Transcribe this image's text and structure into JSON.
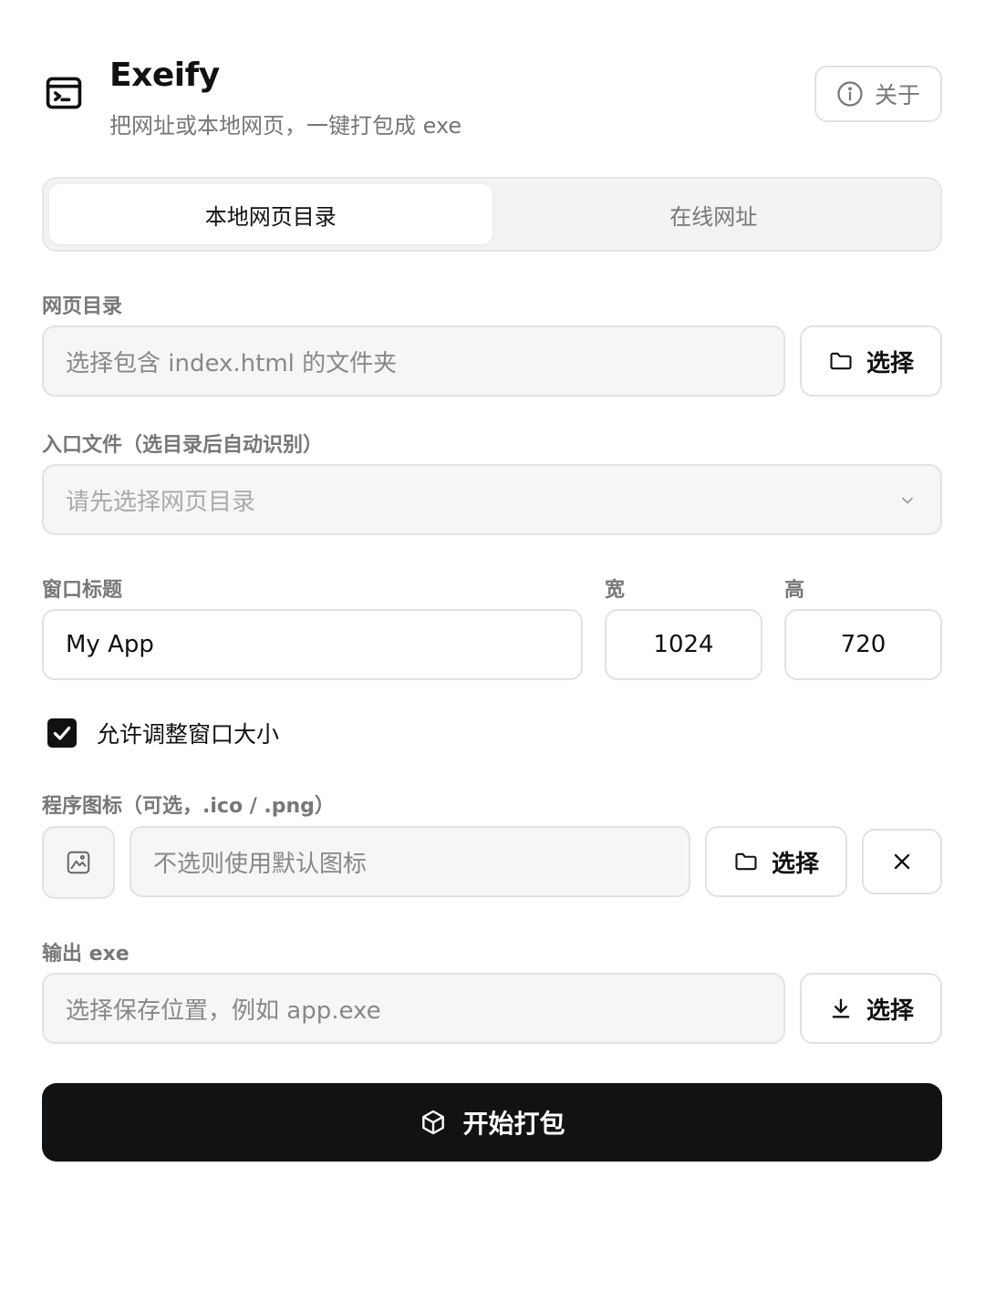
{
  "header": {
    "title": "Exeify",
    "subtitle": "把网址或本地网页，一键打包成 exe",
    "about_label": "关于"
  },
  "tabs": [
    {
      "label": "本地网页目录",
      "active": true
    },
    {
      "label": "在线网址",
      "active": false
    }
  ],
  "web_dir": {
    "label": "网页目录",
    "placeholder": "选择包含 index.html 的文件夹",
    "button_label": "选择"
  },
  "entry": {
    "label": "入口文件（选目录后自动识别）",
    "placeholder": "请先选择网页目录"
  },
  "window": {
    "title_label": "窗口标题",
    "title_value": "My App",
    "width_label": "宽",
    "width_value": "1024",
    "height_label": "高",
    "height_value": "720"
  },
  "resizable": {
    "label": "允许调整窗口大小",
    "checked": true
  },
  "icon": {
    "label": "程序图标（可选，.ico / .png）",
    "placeholder": "不选则使用默认图标",
    "button_label": "选择"
  },
  "output": {
    "label": "输出 exe",
    "placeholder": "选择保存位置，例如 app.exe",
    "button_label": "选择"
  },
  "build_button": {
    "label": "开始打包"
  },
  "colors": {
    "primary": "#111214",
    "muted_text": "#777777",
    "border": "#e2e2e2",
    "input_bg": "#f6f6f6"
  },
  "icons": [
    "terminal-icon",
    "info-icon",
    "folder-icon",
    "chevron-down-icon",
    "check-icon",
    "image-icon",
    "close-icon",
    "download-icon",
    "package-icon"
  ]
}
